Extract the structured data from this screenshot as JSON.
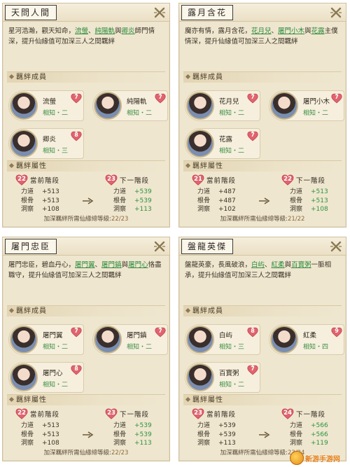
{
  "panels": [
    {
      "title": "天問人間",
      "desc_parts": [
        "星河浩瀚，觀天知命，",
        "流螢",
        "、",
        "純陽軌",
        "與",
        "卿炎",
        "師門情深，提升仙緣值可加深三人之間羈絆"
      ],
      "members_head": "羈絆成員",
      "members": [
        {
          "name": "流螢",
          "rank": "相知・二",
          "level": "7"
        },
        {
          "name": "純陽軌",
          "rank": "相知・二",
          "level": "7"
        },
        {
          "name": "卿炎",
          "rank": "相知・三",
          "level": "8"
        }
      ],
      "attrs_head": "羈絆屬性",
      "cur_level": "22",
      "cur_label": "當前階段",
      "next_level": "23",
      "next_label": "下一階段",
      "stat_names": [
        "力道",
        "根骨",
        "洞察"
      ],
      "cur_values": [
        "+513",
        "+513",
        "+108"
      ],
      "next_values": [
        "+539",
        "+539",
        "+113"
      ],
      "footer_text": "加深羈絆所需仙緣總等級:",
      "footer_value": "22/23"
    },
    {
      "title": "露月含花",
      "desc_parts": [
        "魔亦有情，露月含花，",
        "花月兒",
        "、",
        "屠門小木",
        "與",
        "花露",
        "主僕情深，提升仙緣值可加深三人之間羈絆"
      ],
      "members_head": "羈絆成員",
      "members": [
        {
          "name": "花月兒",
          "rank": "相知・二",
          "level": "7"
        },
        {
          "name": "屠門小木",
          "rank": "相知・二",
          "level": "7"
        },
        {
          "name": "花露",
          "rank": "相知・二",
          "level": "7"
        }
      ],
      "attrs_head": "羈絆屬性",
      "cur_level": "21",
      "cur_label": "當前階段",
      "next_level": "22",
      "next_label": "下一階段",
      "stat_names": [
        "力道",
        "根骨",
        "洞察"
      ],
      "cur_values": [
        "+487",
        "+487",
        "+102"
      ],
      "next_values": [
        "+513",
        "+513",
        "+108"
      ],
      "footer_text": "加深羈絆所需仙緣總等級:",
      "footer_value": "21/22"
    },
    {
      "title": "屠門忠臣",
      "desc_parts": [
        "屠門忠臣，碧血丹心，",
        "屠門翼",
        "、",
        "屠門鎮",
        "與",
        "屠門心",
        "恪盡職守，提升仙緣值可加深三人之間羈絆"
      ],
      "members_head": "羈絆成員",
      "members": [
        {
          "name": "屠門翼",
          "rank": "相知・二",
          "level": "7"
        },
        {
          "name": "屠門鎮",
          "rank": "相知・二",
          "level": "7"
        },
        {
          "name": "屠門心",
          "rank": "相知・二",
          "level": "8"
        }
      ],
      "attrs_head": "羈絆屬性",
      "cur_level": "22",
      "cur_label": "當前階段",
      "next_level": "23",
      "next_label": "下一階段",
      "stat_names": [
        "力道",
        "根骨",
        "洞察"
      ],
      "cur_values": [
        "+513",
        "+513",
        "+108"
      ],
      "next_values": [
        "+539",
        "+539",
        "+113"
      ],
      "footer_text": "加深羈絆所需仙緣總等級:",
      "footer_value": "22/23"
    },
    {
      "title": "盤龍英傑",
      "desc_parts": [
        "盤龍英豪，長風破浪，",
        "白屿",
        "、",
        "紅柔",
        "與",
        "百寶粥",
        "一脈相承，提升仙緣值可加深三人之間羈絆"
      ],
      "members_head": "羈絆成員",
      "members": [
        {
          "name": "白屿",
          "rank": "相知・三",
          "level": "8"
        },
        {
          "name": "紅柔",
          "rank": "相知・四",
          "level": "9"
        },
        {
          "name": "百寶粥",
          "rank": "相知・二",
          "level": "7"
        }
      ],
      "attrs_head": "羈絆屬性",
      "cur_level": "23",
      "cur_label": "當前階段",
      "next_level": "24",
      "next_label": "下一階段",
      "stat_names": [
        "力道",
        "根骨",
        "洞察"
      ],
      "cur_values": [
        "+539",
        "+539",
        "+113"
      ],
      "next_values": [
        "+566",
        "+566",
        "+119"
      ],
      "footer_text": "加深羈絆所需仙緣總等級:",
      "footer_value": "23/24"
    }
  ],
  "watermark": "新游手游网",
  "colors": {
    "panel_bg": "#efe6cf",
    "green": "#2c9440",
    "heart": "#e0646e",
    "link": "#2c8c3c"
  }
}
